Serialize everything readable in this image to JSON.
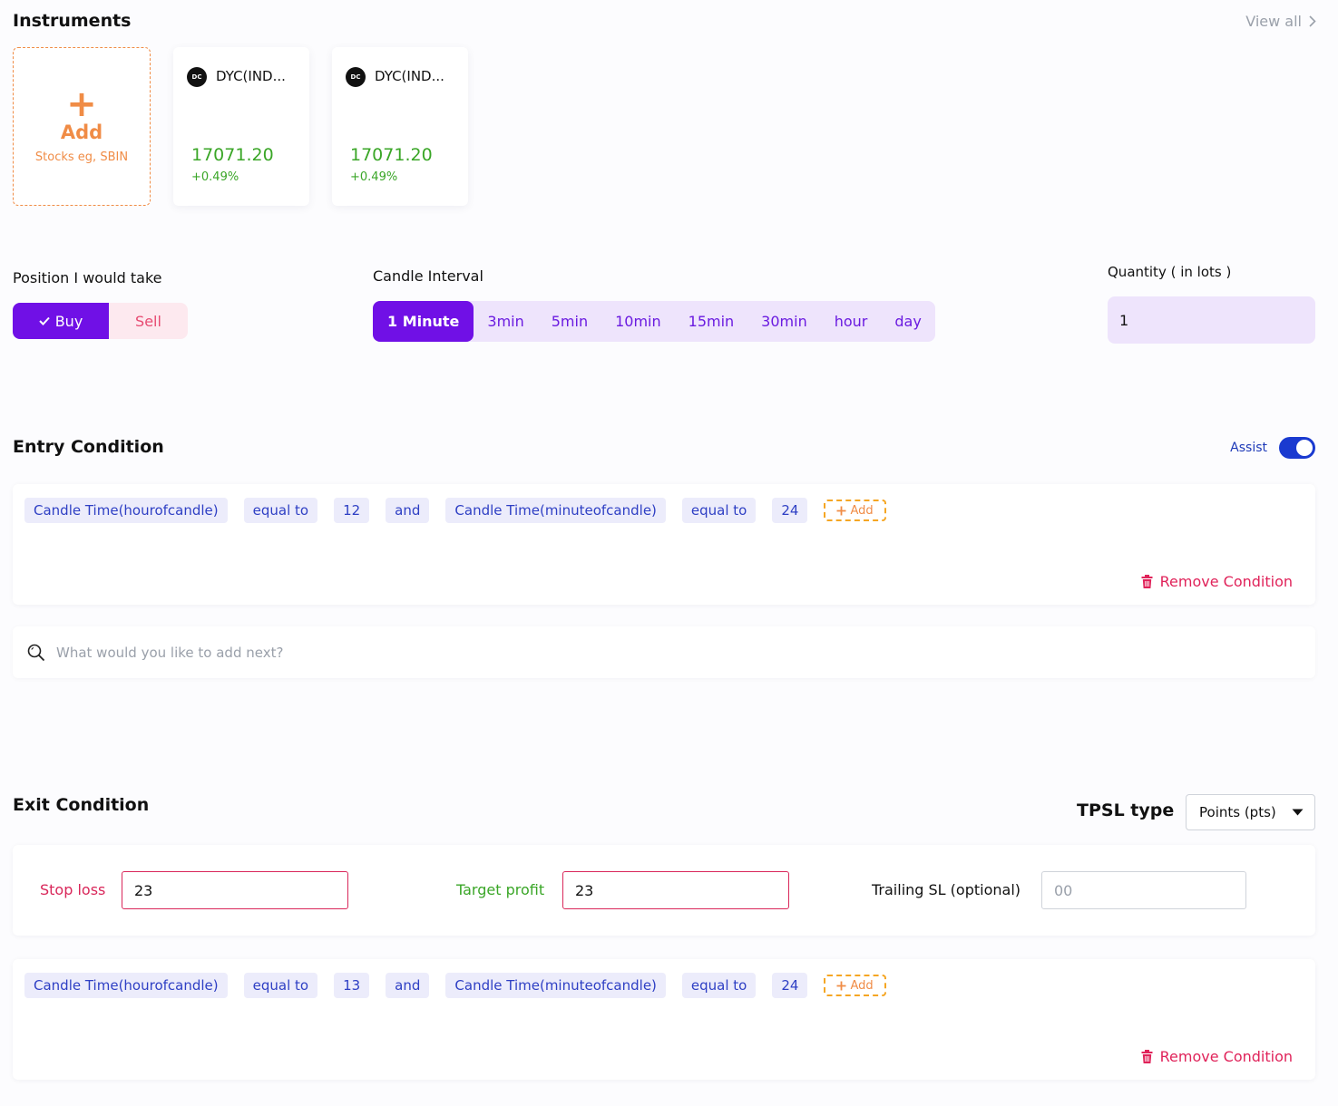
{
  "instruments": {
    "title": "Instruments",
    "view_all": "View all",
    "add_card": {
      "plus": "+",
      "label": "Add",
      "sub": "Stocks eg, SBIN"
    },
    "cards": [
      {
        "logo": "DC",
        "name": "DYC(IND...",
        "price": "17071.20",
        "change": "+0.49%"
      },
      {
        "logo": "DC",
        "name": "DYC(IND...",
        "price": "17071.20",
        "change": "+0.49%"
      }
    ]
  },
  "position": {
    "label": "Position I would take",
    "buy": "Buy",
    "sell": "Sell",
    "selected": "Buy"
  },
  "candle_interval": {
    "label": "Candle Interval",
    "options": [
      "1 Minute",
      "3min",
      "5min",
      "10min",
      "15min",
      "30min",
      "hour",
      "day"
    ],
    "selected": "1 Minute"
  },
  "quantity": {
    "label": "Quantity ( in lots )",
    "value": "1"
  },
  "entry": {
    "title": "Entry Condition",
    "assist_label": "Assist",
    "assist_on": true,
    "chips": [
      "Candle Time(hourofcandle)",
      "equal to",
      "12",
      "and",
      "Candle Time(minuteofcandle)",
      "equal to",
      "24"
    ],
    "add_label": "Add",
    "remove_label": "Remove Condition",
    "search_placeholder": "What would you like to add next?"
  },
  "exit": {
    "title": "Exit Condition",
    "tpsl_label": "TPSL type",
    "tpsl_value": "Points (pts)",
    "stop_loss_label": "Stop loss",
    "stop_loss_value": "23",
    "target_profit_label": "Target profit",
    "target_profit_value": "23",
    "trailing_label": "Trailing SL (optional)",
    "trailing_placeholder": "00",
    "chips": [
      "Candle Time(hourofcandle)",
      "equal to",
      "13",
      "and",
      "Candle Time(minuteofcandle)",
      "equal to",
      "24"
    ],
    "add_label": "Add",
    "remove_label": "Remove Condition"
  },
  "colors": {
    "brand_purple": "#7010e6",
    "accent_orange": "#f08c46",
    "positive_green": "#3aa627",
    "danger_red": "#e0235a",
    "assist_blue": "#1a3ad0"
  }
}
